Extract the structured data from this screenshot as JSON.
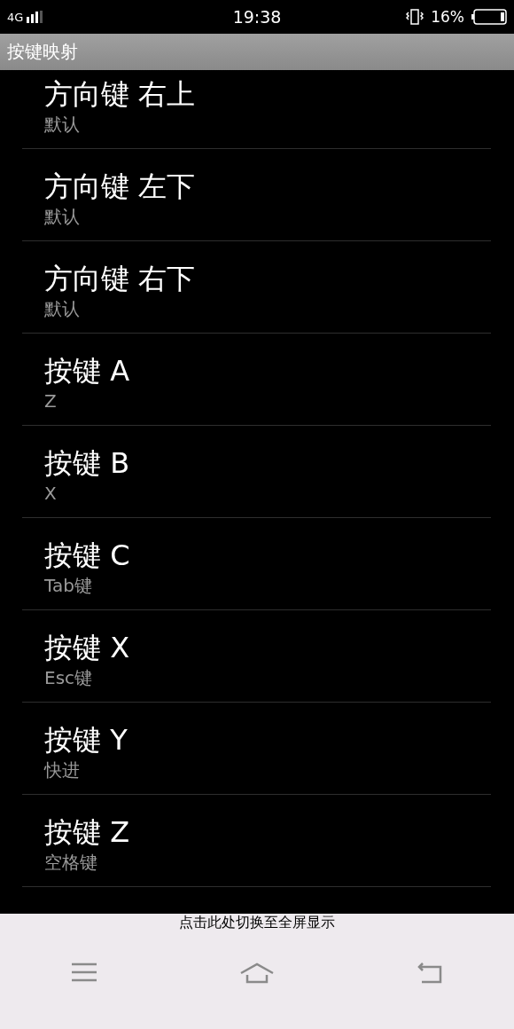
{
  "status_bar": {
    "network": "4G",
    "time": "19:38",
    "battery": "16%"
  },
  "title": "按键映射",
  "items": [
    {
      "title": "方向键 右上",
      "value": "默认"
    },
    {
      "title": "方向键 左下",
      "value": "默认"
    },
    {
      "title": "方向键 右下",
      "value": "默认"
    },
    {
      "title": "按键 A",
      "value": "Z"
    },
    {
      "title": "按键 B",
      "value": "X"
    },
    {
      "title": "按键 C",
      "value": "Tab键"
    },
    {
      "title": "按键 X",
      "value": "Esc键"
    },
    {
      "title": "按键 Y",
      "value": "快进"
    },
    {
      "title": "按键 Z",
      "value": "空格键"
    }
  ],
  "footer": {
    "hint": "点击此处切换至全屏显示"
  }
}
